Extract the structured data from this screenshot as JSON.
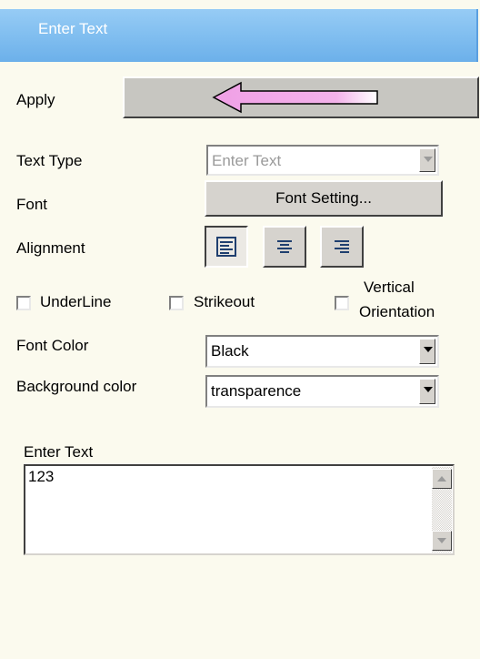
{
  "header": {
    "title": "Enter Text"
  },
  "apply": {
    "label": "Apply",
    "button_icon": "left-arrow-icon"
  },
  "text_type": {
    "label": "Text Type",
    "value": "Enter Text"
  },
  "font": {
    "label": "Font",
    "button_label": "Font Setting..."
  },
  "alignment": {
    "label": "Alignment",
    "options": [
      "left",
      "center",
      "right"
    ],
    "selected": "left"
  },
  "options": {
    "underline": {
      "label": "UnderLine",
      "checked": false
    },
    "strikeout": {
      "label": "Strikeout",
      "checked": false
    },
    "vertical": {
      "label_line1": "Vertical",
      "label_line2": "Orientation",
      "checked": false
    }
  },
  "font_color": {
    "label": "Font Color",
    "value": "Black"
  },
  "background_color": {
    "label": "Background color",
    "value": "transparence"
  },
  "text_entry": {
    "label": "Enter Text",
    "value": "123"
  },
  "colors": {
    "header": "#82bff0",
    "background": "#fbfaee",
    "arrow": "#f0a8e8"
  }
}
